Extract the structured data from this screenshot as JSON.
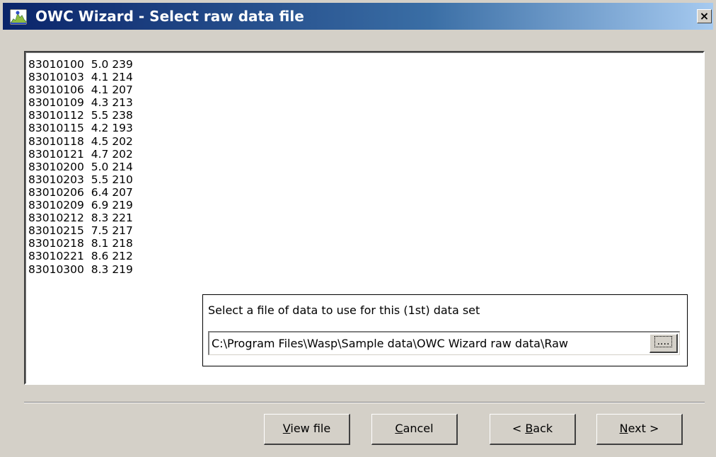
{
  "window": {
    "title": "OWC Wizard - Select raw data file",
    "close_glyph": "×",
    "app_icon": "owc-wizard-icon"
  },
  "data_lines": [
    "83010100  5.0 239",
    "83010103  4.1 214",
    "83010106  4.1 207",
    "83010109  4.3 213",
    "83010112  5.5 238",
    "83010115  4.2 193",
    "83010118  4.5 202",
    "83010121  4.7 202",
    "83010200  5.0 214",
    "83010203  5.5 210",
    "83010206  6.4 207",
    "83010209  6.9 219",
    "83010212  8.3 221",
    "83010215  7.5 217",
    "83010218  8.1 218",
    "83010221  8.6 212",
    "83010300  8.3 219"
  ],
  "file_select": {
    "prompt": "Select a file of data to use for this (1st) data set",
    "path_value": "C:\\Program Files\\Wasp\\Sample data\\OWC Wizard raw data\\Raw",
    "browse_label": "...."
  },
  "buttons": {
    "view_file": {
      "mnemonic": "V",
      "rest": "iew file"
    },
    "cancel": {
      "mnemonic": "C",
      "rest": "ancel"
    },
    "back": {
      "prefix": "< ",
      "mnemonic": "B",
      "rest": "ack"
    },
    "next": {
      "mnemonic": "N",
      "rest": "ext >"
    }
  },
  "colors": {
    "titlebar_start": "#0a246a",
    "titlebar_end": "#a6caf0",
    "face": "#d4d0c8"
  }
}
